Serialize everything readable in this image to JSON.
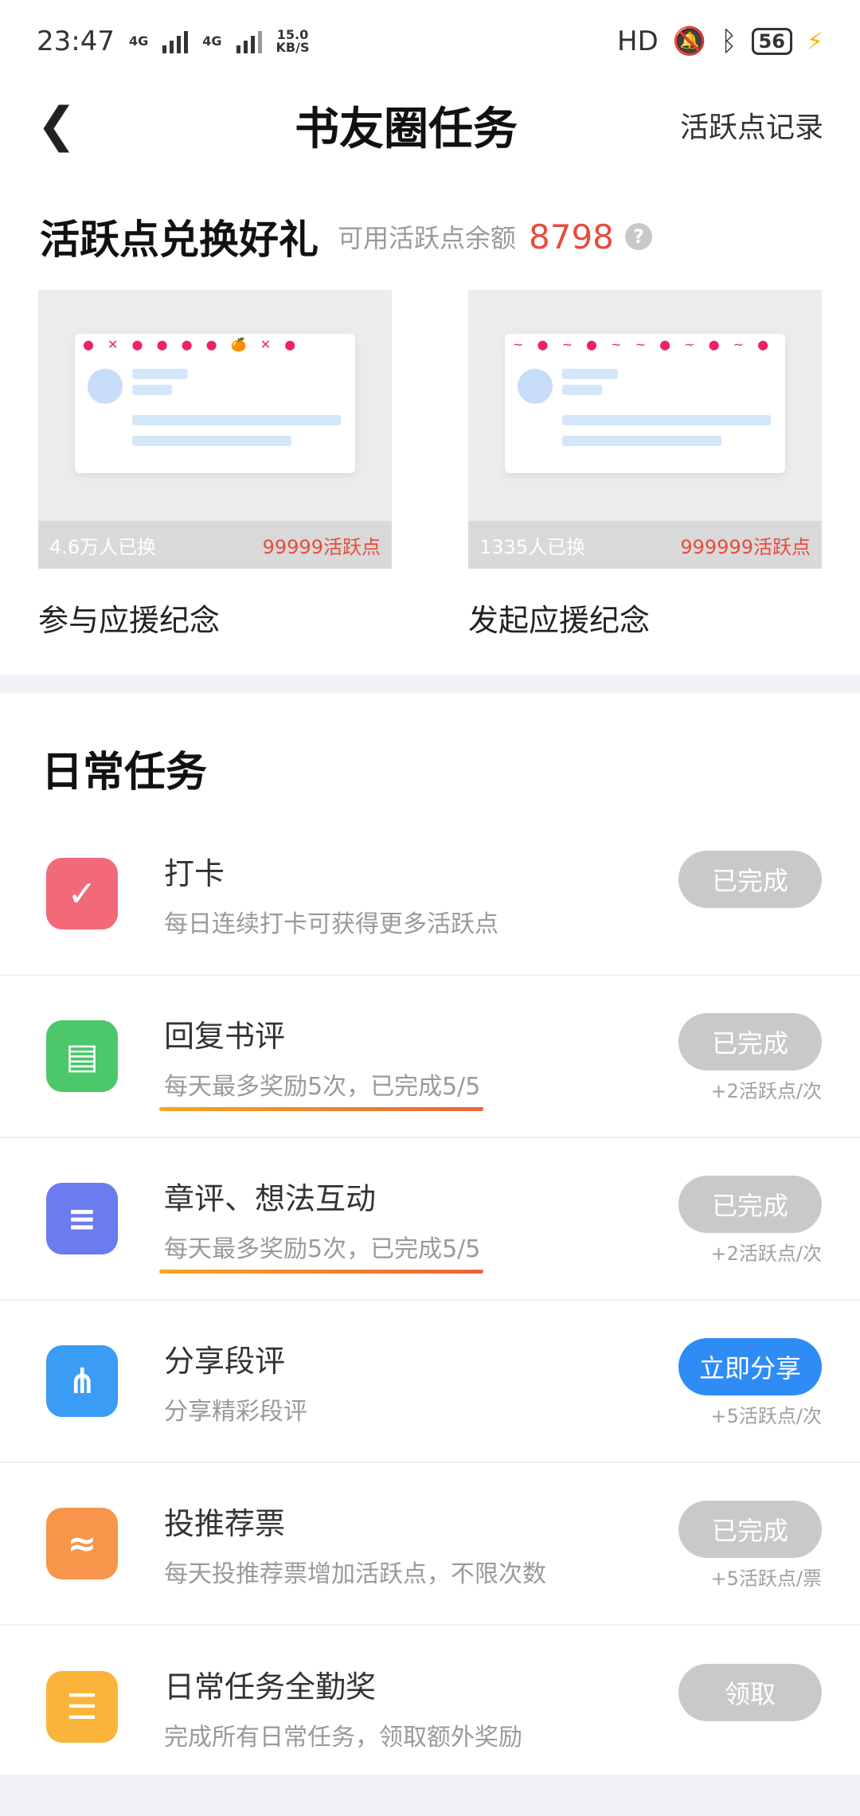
{
  "status_bar": {
    "time": "23:47",
    "net1": "4G",
    "net2": "4G",
    "speed_value": "15.0",
    "speed_unit": "KB/S",
    "hd": "HD",
    "battery": "56"
  },
  "header": {
    "back_icon": "chevron-left-icon",
    "title": "书友圈任务",
    "record_link": "活跃点记录"
  },
  "redeem": {
    "title": "活跃点兑换好礼",
    "balance_label": "可用活跃点余额",
    "balance_value": "8798",
    "help_icon": "question-icon",
    "gifts": [
      {
        "people": "4.6万人已换",
        "points": "99999活跃点",
        "name": "参与应援纪念"
      },
      {
        "people": "1335人已换",
        "points": "999999活跃点",
        "name": "发起应援纪念"
      }
    ]
  },
  "daily": {
    "title": "日常任务",
    "tasks": [
      {
        "icon": "calendar-check-icon",
        "color": "#f26a7a",
        "name": "打卡",
        "desc": "每日连续打卡可获得更多活跃点",
        "button": "已完成",
        "reward": "",
        "active": false
      },
      {
        "icon": "chat-bubble-icon",
        "color": "#4cc76a",
        "name": "回复书评",
        "desc": "每天最多奖励5次，已完成5/5",
        "button": "已完成",
        "reward": "+2活跃点/次",
        "active": false
      },
      {
        "icon": "document-icon",
        "color": "#6b7bf0",
        "name": "章评、想法互动",
        "desc": "每天最多奖励5次，已完成5/5",
        "button": "已完成",
        "reward": "+2活跃点/次",
        "active": false
      },
      {
        "icon": "share-icon",
        "color": "#3a9cf4",
        "name": "分享段评",
        "desc": "分享精彩段评",
        "button": "立即分享",
        "reward": "+5活跃点/次",
        "active": true
      },
      {
        "icon": "ticket-icon",
        "color": "#f7954a",
        "name": "投推荐票",
        "desc": "每天投推荐票增加活跃点，不限次数",
        "button": "已完成",
        "reward": "+5活跃点/票",
        "active": false
      },
      {
        "icon": "list-icon",
        "color": "#fbb43a",
        "name": "日常任务全勤奖",
        "desc": "完成所有日常任务，领取额外奖励",
        "button": "领取",
        "reward": "",
        "active": false
      }
    ]
  }
}
